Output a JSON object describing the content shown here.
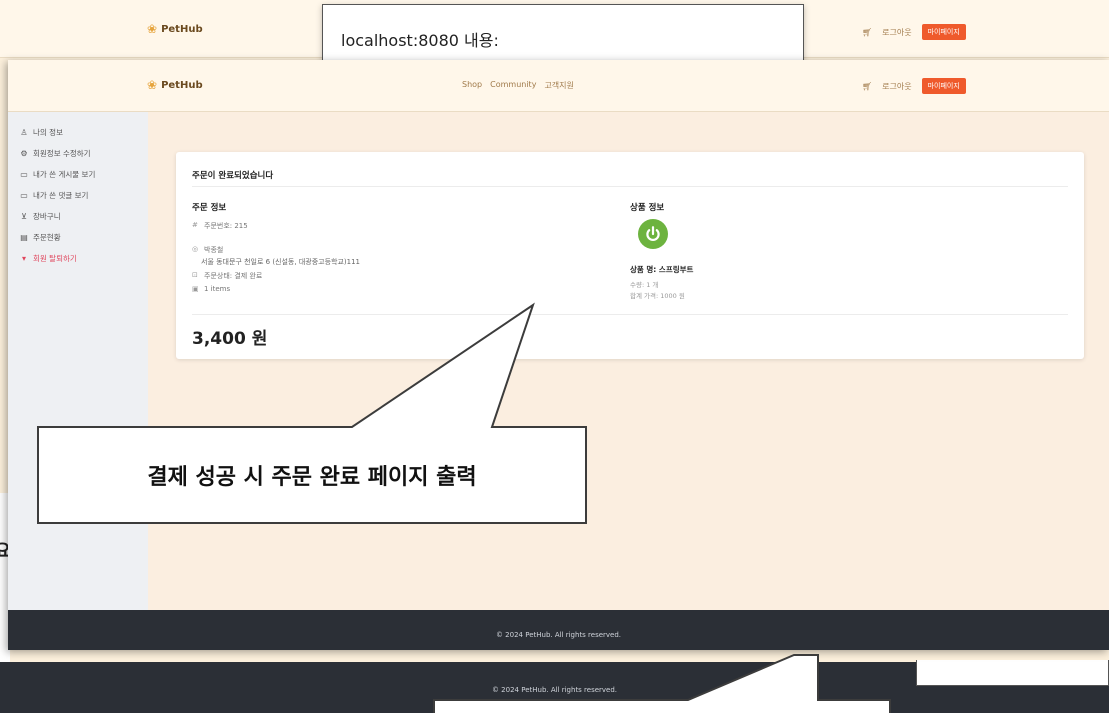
{
  "background_window": {
    "logo": "PetHub",
    "logout_label": "로그아웃",
    "mypage_label": "마이페이지",
    "footer_text": "© 2024 PetHub. All rights reserved.",
    "partial_char": "요"
  },
  "alert": {
    "title": "localhost:8080 내용:"
  },
  "header": {
    "logo": "PetHub",
    "nav": [
      "Shop",
      "Community",
      "고객지원"
    ],
    "logout_label": "로그아웃",
    "mypage_label": "마이페이지",
    "cart_icon": "cart-icon"
  },
  "sidebar": {
    "items": [
      {
        "icon": "person-icon",
        "label": "나의 정보"
      },
      {
        "icon": "gear-icon",
        "label": "회원정보 수정하기"
      },
      {
        "icon": "chat-icon",
        "label": "내가 쓴 게시물 보기"
      },
      {
        "icon": "chat-icon",
        "label": "내가 쓴 댓글 보기"
      },
      {
        "icon": "cart-icon",
        "label": "장바구니"
      },
      {
        "icon": "calendar-icon",
        "label": "주문현황"
      },
      {
        "icon": "trash-icon",
        "label": "회원 탈퇴하기"
      }
    ]
  },
  "order": {
    "title": "주문이 완료되었습니다",
    "order_info_title": "주문 정보",
    "order_number": "주문번호: 215",
    "recipient": "박종철",
    "address": "서울 동대문구 천일로 6 (신설동, 대광중고등학교)111",
    "status": "주문상태: 결제 완료",
    "items_count": "1 items",
    "total": "3,400 원",
    "product_info_title": "상품 정보",
    "product_name": "상품 명: 스프링부트",
    "quantity": "수량: 1 개",
    "subtotal": "합계 가격: 1000 원"
  },
  "footer": {
    "text": "© 2024 PetHub. All rights reserved."
  },
  "callout": {
    "text": "결제 성공 시 주문 완료 페이지 출력"
  },
  "colors": {
    "accent": "#ef5a2c",
    "footer_bg": "#2b2f36",
    "page_bg": "#fbeee0",
    "danger": "#e0475e",
    "spring_green": "#6db33f"
  }
}
